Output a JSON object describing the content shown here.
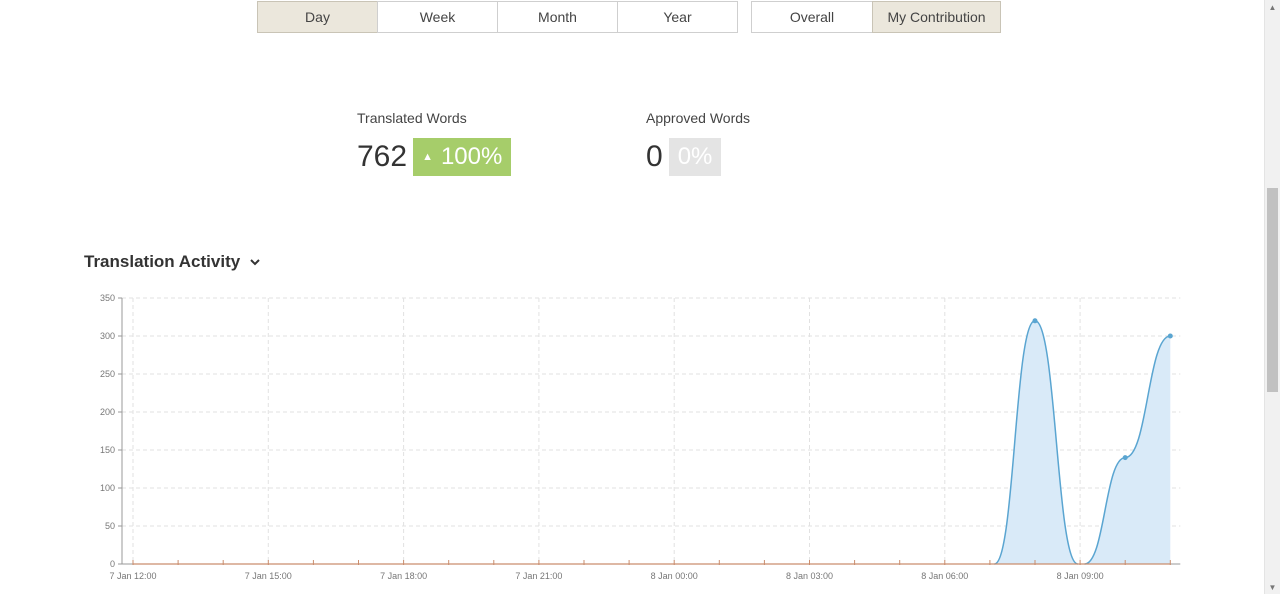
{
  "range_tabs": [
    {
      "label": "Day",
      "active": true
    },
    {
      "label": "Week",
      "active": false
    },
    {
      "label": "Month",
      "active": false
    },
    {
      "label": "Year",
      "active": false
    }
  ],
  "scope_tabs": [
    {
      "label": "Overall",
      "active": false
    },
    {
      "label": "My Contribution",
      "active": true
    }
  ],
  "stats": {
    "translated": {
      "label": "Translated Words",
      "value": "762",
      "change": "100%"
    },
    "approved": {
      "label": "Approved Words",
      "value": "0",
      "change": "0%"
    }
  },
  "section": {
    "title": "Translation Activity"
  },
  "colors": {
    "accent_green": "#a6cd6a",
    "line": "#5aa5d1",
    "fill": "#d9eaf8",
    "active_tab": "#ebe7dc"
  },
  "chart_data": {
    "type": "area",
    "x": [
      "7 Jan 12:00",
      "7 Jan 13:00",
      "7 Jan 14:00",
      "7 Jan 15:00",
      "7 Jan 16:00",
      "7 Jan 17:00",
      "7 Jan 18:00",
      "7 Jan 19:00",
      "7 Jan 20:00",
      "7 Jan 21:00",
      "7 Jan 22:00",
      "7 Jan 23:00",
      "8 Jan 00:00",
      "8 Jan 01:00",
      "8 Jan 02:00",
      "8 Jan 03:00",
      "8 Jan 04:00",
      "8 Jan 05:00",
      "8 Jan 06:00",
      "8 Jan 07:00",
      "8 Jan 08:00",
      "8 Jan 09:00",
      "8 Jan 10:00",
      "8 Jan 11:00"
    ],
    "tick_labels": [
      "7 Jan 12:00",
      "7 Jan 15:00",
      "7 Jan 18:00",
      "7 Jan 21:00",
      "8 Jan 00:00",
      "8 Jan 03:00",
      "8 Jan 06:00",
      "8 Jan 09:00"
    ],
    "y_ticks": [
      0,
      50,
      100,
      150,
      200,
      250,
      300,
      350
    ],
    "ylim": [
      0,
      350
    ],
    "grid": true,
    "series": [
      {
        "values": [
          0,
          0,
          0,
          0,
          0,
          0,
          0,
          0,
          0,
          0,
          0,
          0,
          0,
          0,
          0,
          0,
          0,
          0,
          0,
          0,
          320,
          0,
          140,
          300
        ]
      }
    ]
  }
}
